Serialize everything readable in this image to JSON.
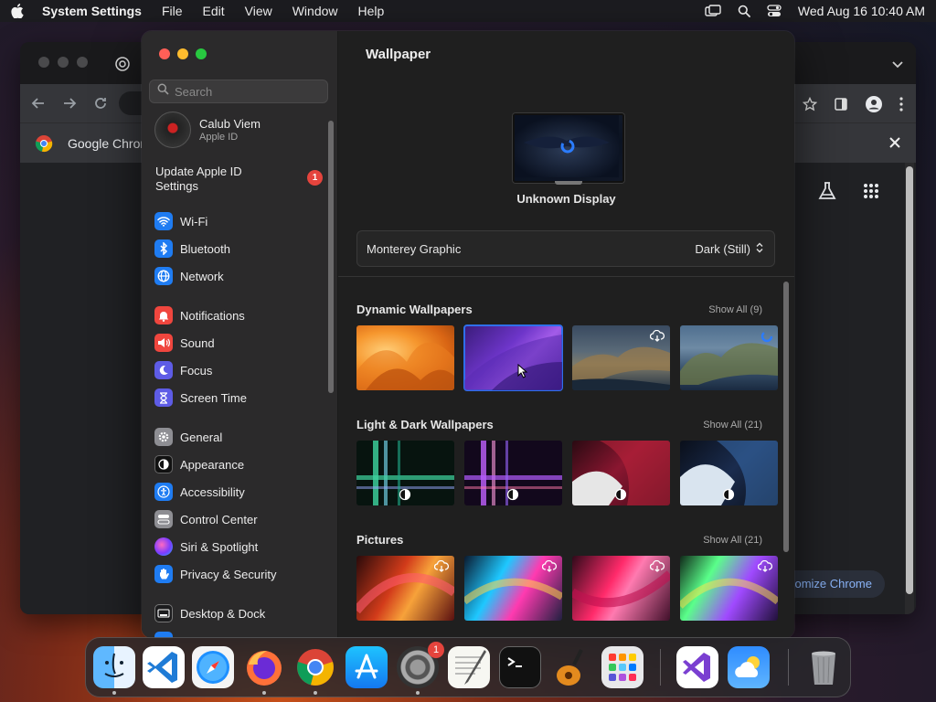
{
  "menubar": {
    "app_name": "System Settings",
    "menus": [
      "File",
      "Edit",
      "View",
      "Window",
      "Help"
    ],
    "clock": "Wed Aug 16  10:40 AM"
  },
  "chrome": {
    "bookmark_label": "Google Chrom",
    "customize_label": "omize Chrome"
  },
  "sidebar": {
    "search_placeholder": "Search",
    "profile_name": "Calub Viem",
    "profile_sub": "Apple ID",
    "update_label": "Update Apple ID Settings",
    "update_badge": "1",
    "group1": [
      "Wi-Fi",
      "Bluetooth",
      "Network"
    ],
    "group2": [
      "Notifications",
      "Sound",
      "Focus",
      "Screen Time"
    ],
    "group3": [
      "General",
      "Appearance",
      "Accessibility",
      "Control Center",
      "Siri & Spotlight",
      "Privacy & Security"
    ],
    "group4": [
      "Desktop & Dock"
    ]
  },
  "main": {
    "title": "Wallpaper",
    "display_label": "Unknown Display",
    "wallpaper_name": "Monterey Graphic",
    "wallpaper_mode": "Dark (Still)",
    "sections": [
      {
        "title": "Dynamic Wallpapers",
        "show_all": "Show All (9)"
      },
      {
        "title": "Light & Dark Wallpapers",
        "show_all": "Show All (21)"
      },
      {
        "title": "Pictures",
        "show_all": "Show All (21)"
      }
    ]
  },
  "dock": {
    "settings_badge": "1"
  },
  "colors": {
    "accent": "#2f6feb",
    "badge": "#e5443d"
  }
}
